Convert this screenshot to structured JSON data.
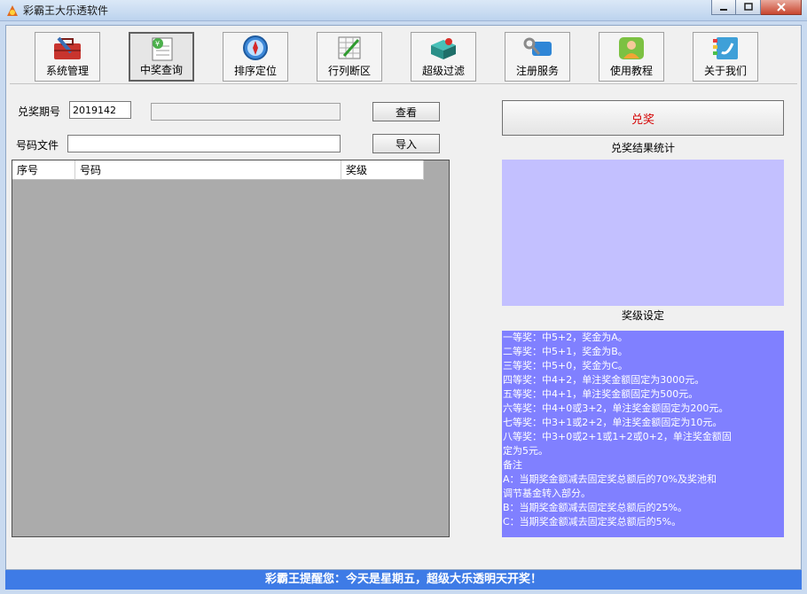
{
  "window": {
    "title": "彩霸王大乐透软件"
  },
  "toolbar": {
    "items": [
      {
        "label": "系统管理",
        "icon": "toolbox-icon"
      },
      {
        "label": "中奖查询",
        "icon": "prize-query-icon",
        "active": true
      },
      {
        "label": "排序定位",
        "icon": "compass-icon"
      },
      {
        "label": "行列断区",
        "icon": "grid-edit-icon"
      },
      {
        "label": "超级过滤",
        "icon": "filter-box-icon"
      },
      {
        "label": "注册服务",
        "icon": "key-card-icon"
      },
      {
        "label": "使用教程",
        "icon": "user-tutorial-icon"
      },
      {
        "label": "关于我们",
        "icon": "phone-book-icon"
      }
    ]
  },
  "query": {
    "period_label": "兑奖期号",
    "period_value": "2019142",
    "status_value": "",
    "view_button": "查看",
    "file_label": "号码文件",
    "file_value": "",
    "import_button": "导入"
  },
  "list": {
    "columns": [
      "序号",
      "号码",
      "奖级"
    ],
    "rows": []
  },
  "prize": {
    "redeem_button": "兑奖",
    "stats_title": "兑奖结果统计",
    "settings_title": "奖级设定",
    "rules": [
      "一等奖：中5+2，奖金为A。",
      "二等奖：中5+1，奖金为B。",
      "三等奖：中5+0，奖金为C。",
      "四等奖：中4+2，单注奖金额固定为3000元。",
      "五等奖：中4+1，单注奖金额固定为500元。",
      "六等奖：中4+0或3+2，单注奖金额固定为200元。",
      "七等奖：中3+1或2+2，单注奖金额固定为10元。",
      "八等奖：中3+0或2+1或1+2或0+2，单注奖金额固",
      "定为5元。",
      "备注",
      "A：当期奖金额减去固定奖总额后的70%及奖池和",
      "调节基金转入部分。",
      "B：当期奖金额减去固定奖总额后的25%。",
      "C：当期奖金额减去固定奖总额后的5%。"
    ]
  },
  "status": {
    "message": "彩霸王提醒您：今天是星期五，超级大乐透明天开奖！"
  },
  "colors": {
    "stats_panel": "#c3c0ff",
    "rules_panel": "#8080ff",
    "status_bar": "#3e7be6",
    "redeem_text": "#d40000"
  }
}
